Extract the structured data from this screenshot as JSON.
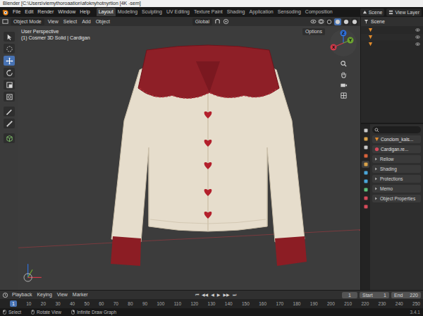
{
  "window": {
    "title": "Blender [C:\\Users\\viemythoroaation\\afoknyhotnyrtion [4K -sem]"
  },
  "menu": [
    "File",
    "Edit",
    "Render",
    "Window",
    "Help"
  ],
  "workspaces": [
    {
      "label": "Layout",
      "selected": true
    },
    {
      "label": "Modeling",
      "selected": false
    },
    {
      "label": "Sculpting",
      "selected": false
    },
    {
      "label": "UV Editing",
      "selected": false
    },
    {
      "label": "Texture Paint",
      "selected": false
    },
    {
      "label": "Shading",
      "selected": false
    },
    {
      "label": "Application",
      "selected": false
    },
    {
      "label": "Sensoding",
      "selected": false
    },
    {
      "label": "Composition",
      "selected": false
    }
  ],
  "scene": "Scene",
  "view_layer": "View Layer",
  "viewport_header": {
    "mode": "Object Mode",
    "menus": [
      "View",
      "Select",
      "Add",
      "Object"
    ],
    "orientation": "Global",
    "shading_modes": [
      {
        "selected": false
      },
      {
        "selected": true
      },
      {
        "selected": false
      },
      {
        "selected": false
      }
    ]
  },
  "tools": [
    {
      "kind": "cursor",
      "selected": false
    },
    {
      "kind": "select",
      "selected": false
    },
    {
      "kind": "move",
      "selected": true
    },
    {
      "kind": "rotate",
      "selected": false
    },
    {
      "kind": "scale",
      "selected": false
    },
    {
      "kind": "transform",
      "selected": false
    },
    {
      "kind": "annotate",
      "selected": false
    },
    {
      "kind": "measure",
      "selected": false
    },
    {
      "kind": "add",
      "selected": false
    }
  ],
  "viewport": {
    "perspective": "User Perspective",
    "object": "(1) Cosmer 3D Solid | Cardigan",
    "options": "Options"
  },
  "gizmo": [
    {
      "label": "Z",
      "color": "#2f6fd8"
    },
    {
      "label": "Y",
      "color": "#6da430"
    },
    {
      "label": "X",
      "color": "#d13a4a"
    }
  ],
  "outliner": {
    "header": "Scene",
    "rows": [
      {
        "color": "#e08a2c",
        "visible": true
      },
      {
        "color": "#e08a2c",
        "visible": true
      },
      {
        "color": "#e08a2c",
        "visible": true
      }
    ]
  },
  "properties": {
    "tabs": [
      {
        "color": "#c9c9c9",
        "selected": false
      },
      {
        "color": "#d9a24a",
        "selected": false
      },
      {
        "color": "#c9c9c9",
        "selected": false
      },
      {
        "color": "#d6613a",
        "selected": false
      },
      {
        "color": "#d9a24a",
        "selected": true
      },
      {
        "color": "#4aa6d9",
        "selected": false
      },
      {
        "color": "#4aa6d9",
        "selected": false
      },
      {
        "color": "#5fc07a",
        "selected": false
      },
      {
        "color": "#d64a5a",
        "selected": false
      },
      {
        "color": "#d64a5a",
        "selected": false
      }
    ],
    "fields": [
      "Conclom_kals...",
      "Cardigan.re..."
    ],
    "sections": [
      {
        "label": "Rellow",
        "expanded": false
      },
      {
        "label": "Shading",
        "expanded": false
      },
      {
        "label": "Protections",
        "expanded": false
      },
      {
        "label": "Memo",
        "expanded": false
      },
      {
        "label": "Object Properties",
        "expanded": false
      }
    ]
  },
  "timeline": {
    "menus": [
      "Playback",
      "Keying",
      "View",
      "Marker"
    ],
    "controls": [
      "⏮",
      "◀◀",
      "◀",
      "▶",
      "▶▶",
      "⏭"
    ],
    "current_frame": "1",
    "start_label": "Start",
    "start": "1",
    "end_label": "End",
    "end": "220",
    "playhead": "1",
    "ticks": [
      "10",
      "20",
      "30",
      "40",
      "50",
      "60",
      "70",
      "80",
      "90",
      "100",
      "110",
      "120",
      "130",
      "140",
      "150",
      "160",
      "170",
      "180",
      "190",
      "200",
      "210",
      "220",
      "230",
      "240",
      "250"
    ]
  },
  "status_bar": {
    "items": [
      "Select",
      "Rotate View",
      "Infinite Draw Graph"
    ],
    "version": "3.4.1"
  }
}
